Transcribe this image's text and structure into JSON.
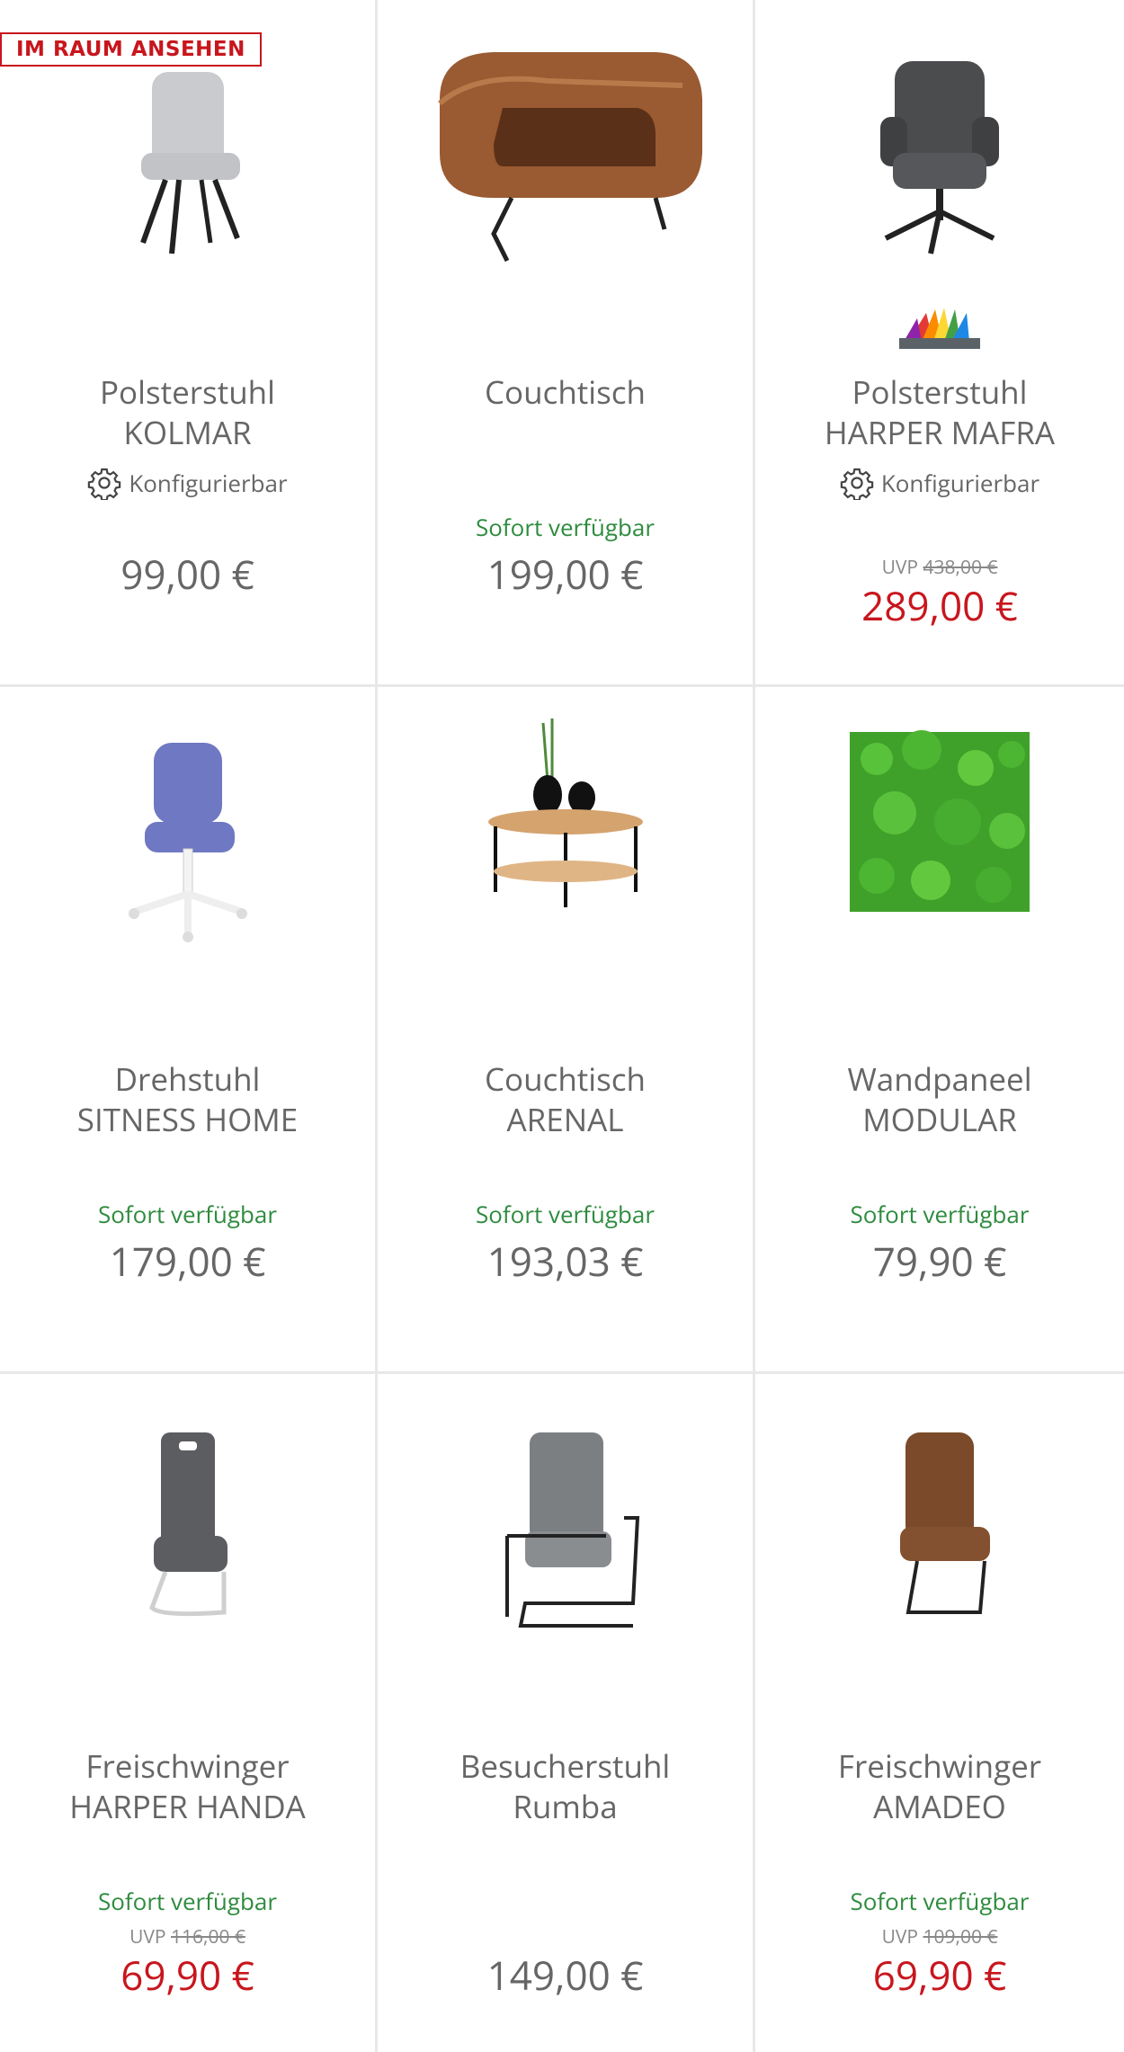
{
  "products": [
    {
      "badge": "IM RAUM ANSEHEN",
      "title": "Polsterstuhl\nKOLMAR",
      "config": "Konfigurierbar",
      "price": "99,00 €"
    },
    {
      "title": "Couchtisch",
      "avail": "Sofort verfügbar",
      "price": "199,00 €"
    },
    {
      "title": "Polsterstuhl\nHARPER MAFRA",
      "config": "Konfigurierbar",
      "uvp_label": "UVP",
      "uvp_price": "438,00 €",
      "price": "289,00 €"
    },
    {
      "title": "Drehstuhl\nSITNESS HOME",
      "avail": "Sofort verfügbar",
      "price": "179,00 €"
    },
    {
      "title": "Couchtisch\nARENAL",
      "avail": "Sofort verfügbar",
      "price": "193,03 €"
    },
    {
      "title": "Wandpaneel\nMODULAR",
      "avail": "Sofort verfügbar",
      "price": "79,90 €"
    },
    {
      "title": "Freischwinger\nHARPER HANDA",
      "avail": "Sofort verfügbar",
      "uvp_label": "UVP",
      "uvp_price": "116,00 €",
      "price": "69,90 €"
    },
    {
      "title": "Besucherstuhl\nRumba",
      "price": "149,00 €"
    },
    {
      "title": "Freischwinger\nAMADEO",
      "avail": "Sofort verfügbar",
      "uvp_label": "UVP",
      "uvp_price": "109,00 €",
      "price": "69,90 €"
    }
  ],
  "colors": {
    "sale_red": "#c8161d",
    "available_green": "#2e8b3e",
    "text_gray": "#666666",
    "divider": "#e8e8e8"
  }
}
